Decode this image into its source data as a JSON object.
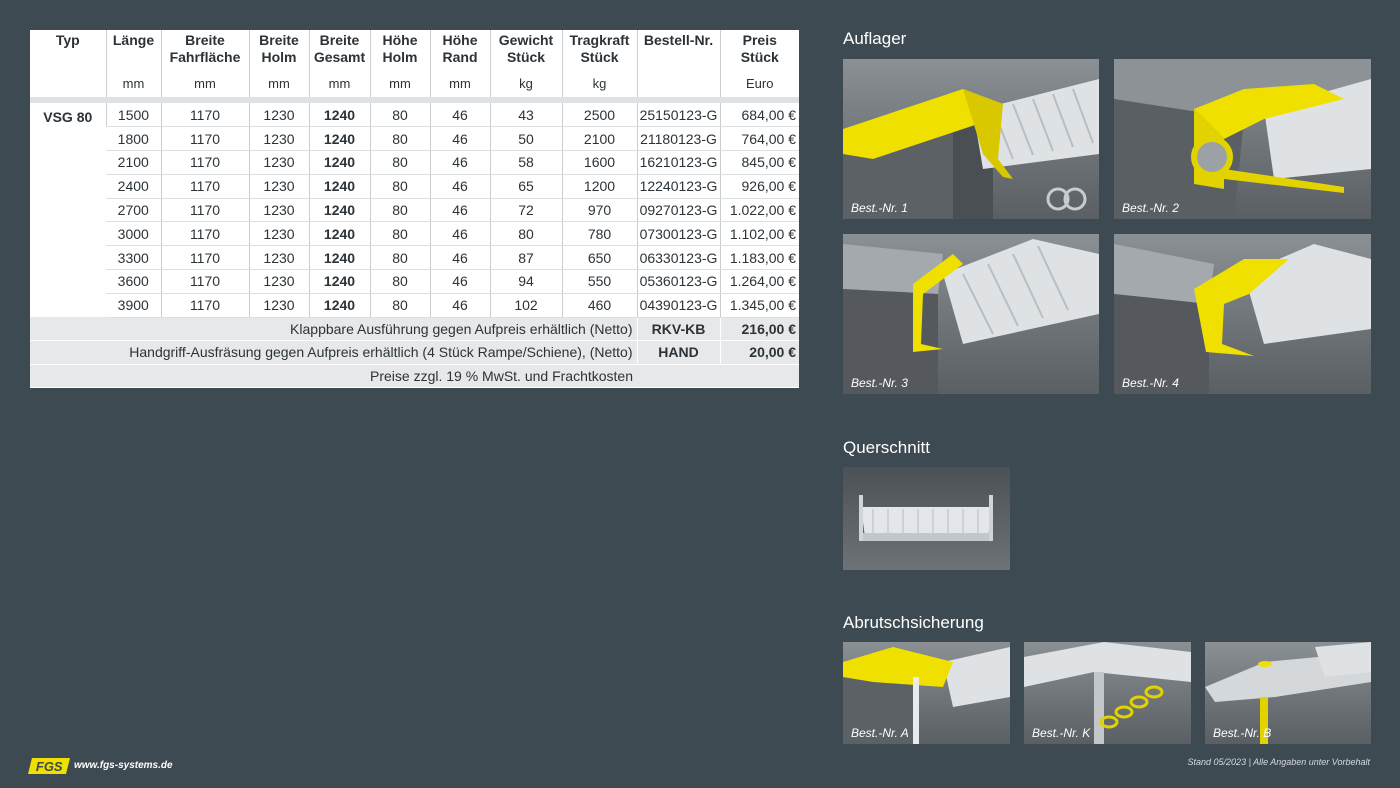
{
  "table": {
    "headers": [
      "Typ",
      "Länge",
      "Breite\nFahrfläche",
      "Breite\nHolm",
      "Breite\nGesamt",
      "Höhe\nHolm",
      "Höhe\nRand",
      "Gewicht\nStück",
      "Tragkraft\nStück",
      "Bestell-Nr.",
      "Preis\nStück"
    ],
    "units": [
      "",
      "mm",
      "mm",
      "mm",
      "mm",
      "mm",
      "mm",
      "kg",
      "kg",
      "",
      "Euro"
    ],
    "type_label": "VSG 80",
    "rows": [
      [
        "1500",
        "1170",
        "1230",
        "1240",
        "80",
        "46",
        "43",
        "2500",
        "25150123-G",
        "684,00 €"
      ],
      [
        "1800",
        "1170",
        "1230",
        "1240",
        "80",
        "46",
        "50",
        "2100",
        "21180123-G",
        "764,00 €"
      ],
      [
        "2100",
        "1170",
        "1230",
        "1240",
        "80",
        "46",
        "58",
        "1600",
        "16210123-G",
        "845,00 €"
      ],
      [
        "2400",
        "1170",
        "1230",
        "1240",
        "80",
        "46",
        "65",
        "1200",
        "12240123-G",
        "926,00 €"
      ],
      [
        "2700",
        "1170",
        "1230",
        "1240",
        "80",
        "46",
        "72",
        "970",
        "09270123-G",
        "1.022,00 €"
      ],
      [
        "3000",
        "1170",
        "1230",
        "1240",
        "80",
        "46",
        "80",
        "780",
        "07300123-G",
        "1.102,00 €"
      ],
      [
        "3300",
        "1170",
        "1230",
        "1240",
        "80",
        "46",
        "87",
        "650",
        "06330123-G",
        "1.183,00 €"
      ],
      [
        "3600",
        "1170",
        "1230",
        "1240",
        "80",
        "46",
        "94",
        "550",
        "05360123-G",
        "1.264,00 €"
      ],
      [
        "3900",
        "1170",
        "1230",
        "1240",
        "80",
        "46",
        "102",
        "460",
        "04390123-G",
        "1.345,00 €"
      ]
    ],
    "footer": [
      {
        "note": "Klappbare Ausführung gegen Aufpreis erhältlich (Netto)",
        "code": "RKV-KB",
        "price": "216,00 €"
      },
      {
        "note": "Handgriff-Ausfräsung gegen Aufpreis erhältlich (4 Stück Rampe/Schiene), (Netto)",
        "code": "HAND",
        "price": "20,00 €"
      }
    ],
    "price_note": "Preise zzgl. 19 % MwSt. und Frachtkosten"
  },
  "sections": {
    "auflager": {
      "title": "Auflager",
      "captions": [
        "Best.-Nr. 1",
        "Best.-Nr. 2",
        "Best.-Nr. 3",
        "Best.-Nr. 4"
      ]
    },
    "querschnitt": {
      "title": "Querschnitt"
    },
    "abrutsch": {
      "title": "Abrutschsicherung",
      "captions": [
        "Best.-Nr. A",
        "Best.-Nr. K",
        "Best.-Nr. B"
      ]
    }
  },
  "footer": {
    "logo": "FGS",
    "website": "www.fgs-systems.de",
    "stand": "Stand 05/2023 | Alle Angaben unter Vorbehalt"
  },
  "colors": {
    "background": "#3d4a51",
    "accent_yellow": "#f0e000",
    "table_bg": "#ffffff"
  }
}
